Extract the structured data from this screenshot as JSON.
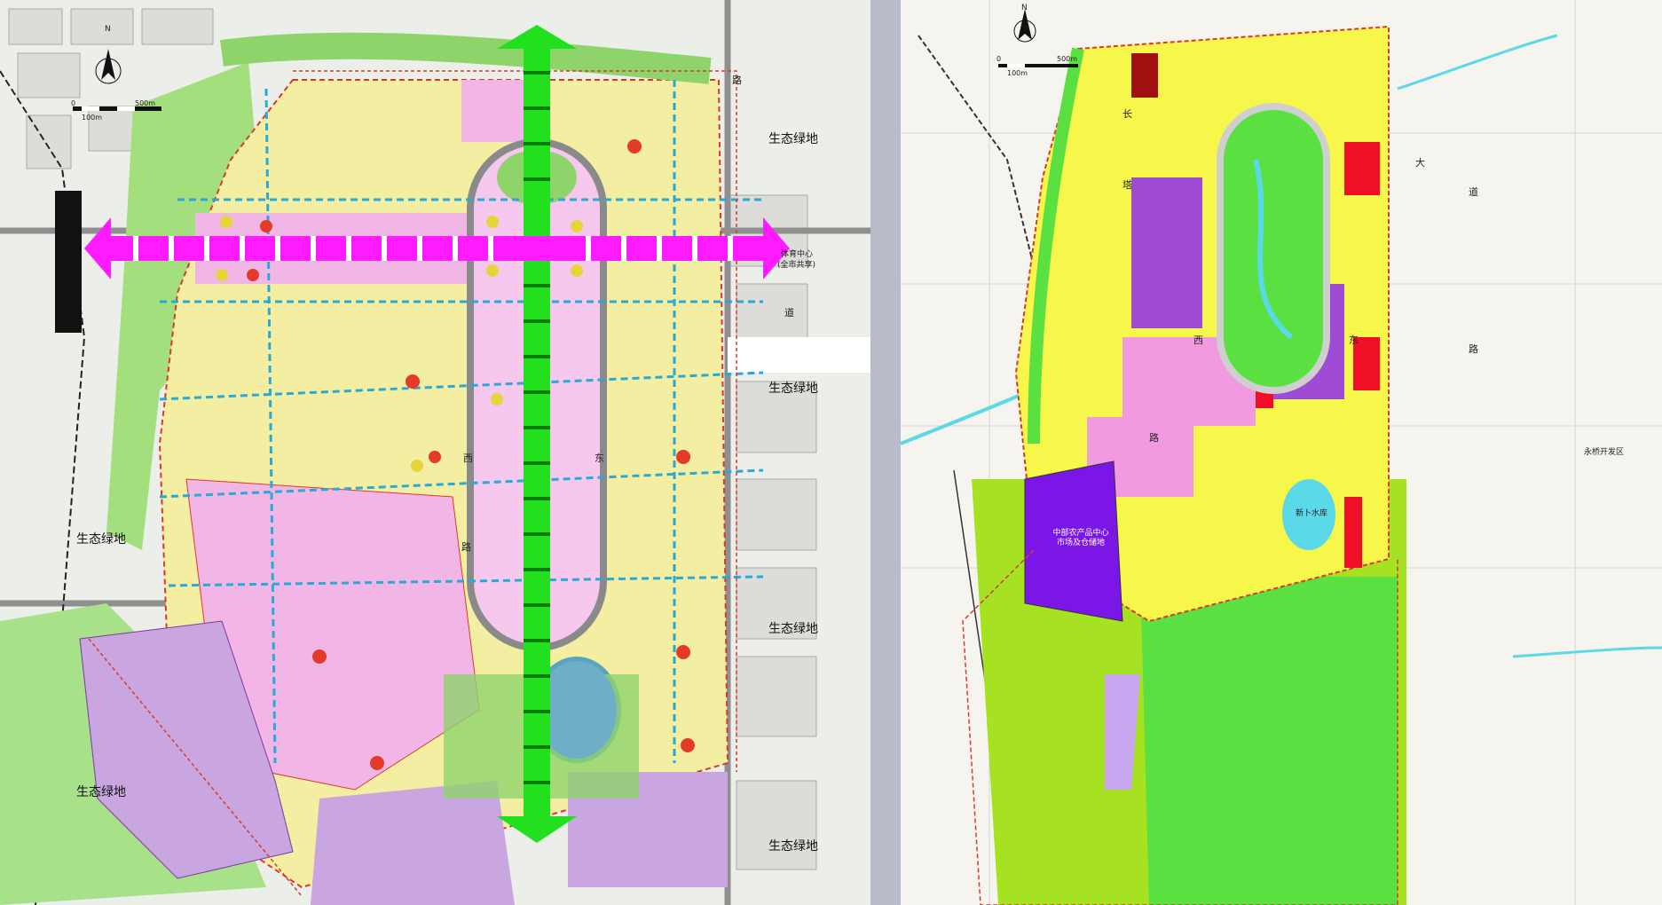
{
  "left_map": {
    "north_label": "N",
    "scale_labels": [
      "0",
      "100m",
      "500m"
    ],
    "eco_green_label": "生态绿地",
    "sports_center_label": "体育中心",
    "sports_center_sub": "(全市共享)",
    "road_chars": [
      "路",
      "道",
      "西",
      "东",
      "路"
    ],
    "colors": {
      "residential": "#f3eea2",
      "commercial": "#f2b6e6",
      "industrial": "#c9a6e0",
      "green": "#8fd36b",
      "axis_green": "#22e01d",
      "axis_magenta": "#ff1bff",
      "road_blue": "#29a9d6"
    }
  },
  "right_map": {
    "north_label": "N",
    "scale_labels": [
      "0",
      "100m",
      "500m"
    ],
    "industrial_label": "中部农产品中心市场及仓储地",
    "lake_label": "新卜水库",
    "district_label": "永桥开发区",
    "road_chars": [
      "长",
      "塔",
      "大",
      "道",
      "东",
      "西",
      "路",
      "路"
    ],
    "colors": {
      "residential": "#f7f64a",
      "commercial": "#ef0f26",
      "public_facility": "#a04bd6",
      "pink_mixed": "#f29ae0",
      "industrial_purple": "#7a16e6",
      "green": "#5ae041",
      "farmland": "#a6e221",
      "water": "#5bd9e8"
    }
  }
}
